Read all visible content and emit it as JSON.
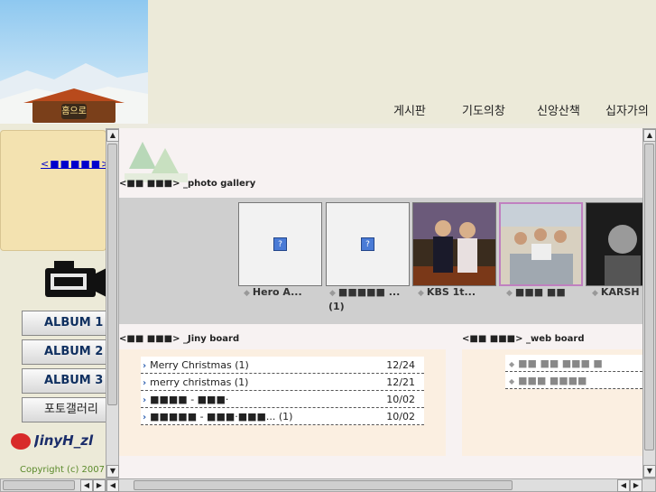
{
  "header": {
    "home_label": "홈으로",
    "nav": [
      "게시판",
      "기도의창",
      "신앙산책",
      "십자가의"
    ]
  },
  "left": {
    "paper_link": "<■■■■■>",
    "albums": [
      "ALBUM 1",
      "ALBUM 2",
      "ALBUM 3",
      "포토갤러리"
    ],
    "logo": "JinyH_zl",
    "copyright": "Copyright (c) 2007"
  },
  "gallery": {
    "title_prefix": "<■■ ■■■>",
    "title": "_photo gallery",
    "items": [
      {
        "caption": "Hero A...",
        "extra": "",
        "type": "missing"
      },
      {
        "caption": "■■■■■ ...",
        "extra": "(1)",
        "type": "missing"
      },
      {
        "caption": "KBS 1t...",
        "extra": "",
        "type": "photo1"
      },
      {
        "caption": "■■■ ■■",
        "extra": "",
        "type": "photo2"
      },
      {
        "caption": "KARSH ...",
        "extra": "",
        "type": "photo3"
      }
    ]
  },
  "jiny_board": {
    "title_prefix": "<■■ ■■■>",
    "title": "_Jiny board",
    "posts": [
      {
        "title": "Merry Christmas (1)",
        "date": "12/24"
      },
      {
        "title": "merry christmas (1)",
        "date": "12/21"
      },
      {
        "title": "■■■■ - ■■■·",
        "date": "10/02"
      },
      {
        "title": "■■■■■ - ■■■·■■■... (1)",
        "date": "10/02"
      }
    ]
  },
  "web_board": {
    "title_prefix": "<■■ ■■■>",
    "title": "_web board",
    "posts": [
      "■■ ■■ ■■■ ■",
      "■■■ ■■■■"
    ]
  }
}
